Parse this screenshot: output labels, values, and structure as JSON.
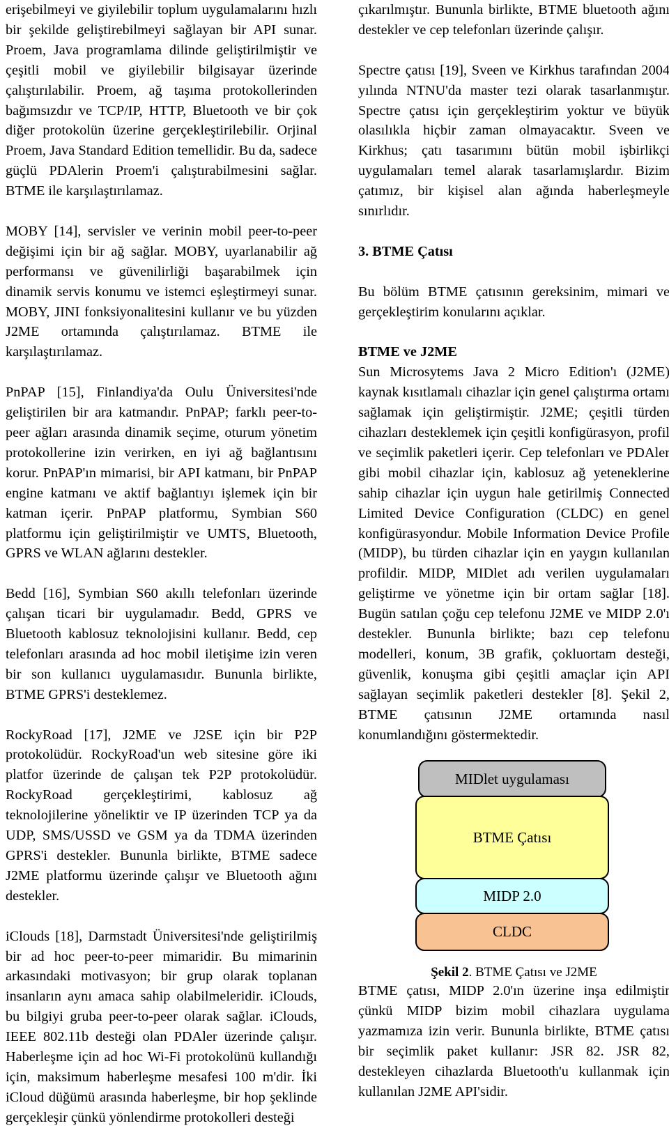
{
  "document": {
    "language": "tr",
    "left_column": {
      "paragraphs": [
        "erişebilmeyi ve giyilebilir toplum uygulamalarını hızlı bir şekilde geliştirebilmeyi sağlayan bir API sunar. Proem, Java programlama dilinde geliştirilmiştir ve çeşitli mobil ve giyilebilir bilgisayar üzerinde çalıştırılabilir. Proem, ağ taşıma protokollerinden bağımsızdır ve TCP/IP, HTTP, Bluetooth ve bir çok diğer protokolün üzerine gerçekleştirilebilir. Orjinal Proem, Java Standard Edition temellidir. Bu da, sadece güçlü PDAlerin Proem'i çalıştırabilmesini sağlar. BTME ile karşılaştırılamaz.",
        "MOBY [14], servisler ve verinin mobil peer-to-peer değişimi için bir ağ sağlar. MOBY, uyarlanabilir ağ performansı ve güvenilirliği başarabilmek için dinamik servis konumu ve istemci eşleştirmeyi sunar. MOBY, JINI fonksiyonalitesini kullanır ve bu yüzden J2ME ortamında çalıştırılamaz. BTME ile karşılaştırılamaz.",
        "PnPAP [15], Finlandiya'da Oulu Üniversitesi'nde geliştirilen bir ara katmandır. PnPAP; farklı peer-to-peer ağları arasında dinamik seçime, oturum yönetim protokollerine izin verirken, en iyi ağ bağlantısını korur. PnPAP'ın mimarisi, bir API katmanı, bir PnPAP engine katmanı ve aktif bağlantıyı işlemek için bir katman içerir. PnPAP platformu, Symbian S60 platformu için geliştirilmiştir ve UMTS, Bluetooth, GPRS ve WLAN ağlarını destekler.",
        "Bedd [16], Symbian S60 akıllı telefonları üzerinde çalışan ticari bir uygulamadır. Bedd, GPRS ve Bluetooth kablosuz teknolojisini kullanır. Bedd, cep telefonları arasında ad hoc mobil iletişime izin veren bir son kullanıcı uygulamasıdır. Bununla birlikte, BTME GPRS'i desteklemez.",
        "RockyRoad [17], J2ME ve J2SE için bir P2P protokolüdür. RockyRoad'un web sitesine göre iki platfor üzerinde de çalışan tek P2P protokolüdür. RockyRoad gerçekleştirimi, kablosuz ağ teknolojilerine yöneliktir ve IP üzerinden TCP ya da UDP, SMS/USSD ve GSM ya da TDMA üzerinden GPRS'i destekler. Bununla birlikte, BTME sadece J2ME platformu üzerinde çalışır ve Bluetooth ağını destekler.",
        "iClouds [18], Darmstadt Üniversitesi'nde geliştirilmiş bir ad hoc peer-to-peer mimaridir. Bu mimarinin arkasındaki motivasyon; bir grup olarak toplanan insanların aynı amaca sahip olabilmeleridir. iClouds, bu bilgiyi gruba peer-to-peer olarak sağlar. iClouds, IEEE 802.11b desteği olan PDAler üzerinde çalışır. Haberleşme için ad hoc Wi-Fi protokolünü kullandığı için, maksimum haberleşme mesafesi 100 m'dir. İki iCloud düğümü arasında haberleşme, bir hop şeklinde gerçekleşir çünkü yönlendirme protokolleri desteği"
      ]
    },
    "right_column": {
      "paragraph_intro": "çıkarılmıştır. Bununla birlikte, BTME bluetooth ağını destekler ve cep telefonları üzerinde çalışır.",
      "paragraph_spectre": "Spectre çatısı [19], Sveen ve Kirkhus tarafından 2004 yılında NTNU'da master tezi olarak tasarlanmıştır. Spectre çatısı için gerçekleştirim yoktur ve büyük olasılıkla hiçbir zaman olmayacaktır. Sveen ve Kirkhus; çatı tasarımını bütün mobil işbirlikçi uygulamaları temel alarak tasarlamışlardır. Bizim çatımız, bir kişisel alan ağında haberleşmeyle sınırlıdır.",
      "section_heading": "3. BTME Çatısı",
      "paragraph_section_intro": "Bu bölüm BTME çatısının gereksinim, mimari ve gerçekleştirim konularını açıklar.",
      "subsection_heading": "BTME ve J2ME",
      "paragraph_j2me": "Sun Microsytems Java 2 Micro Edition'ı (J2ME) kaynak kısıtlamalı cihazlar için genel çalıştırma ortamı sağlamak için geliştirmiştir. J2ME; çeşitli türden cihazları desteklemek için çeşitli konfigürasyon, profil ve seçimlik paketleri içerir. Cep telefonları ve PDAler gibi mobil cihazlar için, kablosuz ağ yeteneklerine sahip cihazlar için uygun hale getirilmiş Connected Limited Device Configuration (CLDC) en genel konfigürasyondur. Mobile Information Device Profile (MIDP), bu türden cihazlar için en yaygın kullanılan profildir. MIDP, MIDlet adı verilen uygulamaları geliştirme ve yönetme için bir ortam sağlar [18]. Bugün satılan çoğu cep telefonu J2ME ve MIDP 2.0'ı destekler. Bununla birlikte; bazı cep telefonu modelleri, konum, 3B grafik, çokluortam desteği, güvenlik, konuşma gibi çeşitli amaçlar için API sağlayan seçimlik paketleri destekler [8]. Şekil 2, BTME çatısının J2ME ortamında nasıl konumlandığını göstermektedir.",
      "paragraph_after_figure": "BTME çatısı, MIDP 2.0'ın üzerine inşa edilmiştir çünkü MIDP bizim mobil cihazlara uygulama yazmamıza izin verir. Bununla birlikte, BTME çatısı bir seçimlik paket kullanır: JSR 82. JSR 82, destekleyen cihazlarda Bluetooth'u kullanmak için kullanılan J2ME API'sidir."
    },
    "figure": {
      "caption_label": "Şekil 2",
      "caption_text": ". BTME Çatısı ve J2ME",
      "layers": [
        {
          "label": "MIDlet uygulaması",
          "color": "#BFBFBF"
        },
        {
          "label": "BTME Çatısı",
          "color": "#FFFF99"
        },
        {
          "label": "MIDP 2.0",
          "color": "#CCFFFF"
        },
        {
          "label": "CLDC",
          "color": "#F9C293"
        }
      ]
    }
  }
}
